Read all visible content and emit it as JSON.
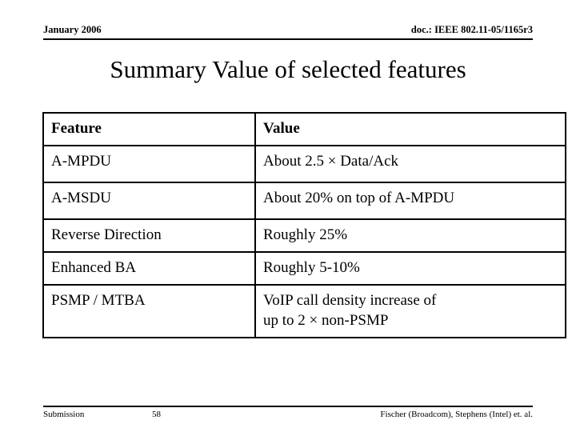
{
  "header": {
    "date": "January 2006",
    "doc": "doc.: IEEE 802.11-05/1165r3"
  },
  "title": "Summary Value of selected features",
  "table": {
    "columns": [
      "Feature",
      "Value"
    ],
    "rows": [
      {
        "feature": "A-MPDU",
        "value_lines": [
          "About 2.5 × Data/Ack"
        ]
      },
      {
        "feature": "A-MSDU",
        "value_lines": [
          "About 20% on top of A-MPDU"
        ]
      },
      {
        "feature": "Reverse Direction",
        "value_lines": [
          "Roughly 25%"
        ]
      },
      {
        "feature": "Enhanced BA",
        "value_lines": [
          "Roughly 5-10%"
        ]
      },
      {
        "feature": "PSMP / MTBA",
        "value_lines": [
          "VoIP call density increase of",
          "up to 2 × non-PSMP"
        ]
      }
    ]
  },
  "footer": {
    "left": "Submission",
    "page": "58",
    "right": "Fischer (Broadcom), Stephens (Intel) et. al."
  },
  "colors": {
    "text": "#000000",
    "background": "#ffffff",
    "rule": "#000000"
  }
}
